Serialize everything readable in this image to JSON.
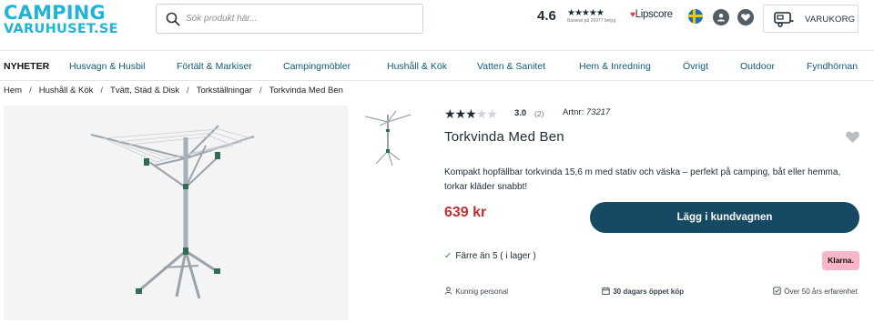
{
  "header": {
    "logo_line1": "CAMPING",
    "logo_line2": "VARUHUSET.SE",
    "search_placeholder": "Sök produkt här...",
    "store_rating": "4.6",
    "rating_stars": "★★★★★",
    "rating_subtext": "Baserat på 26977 betyg",
    "lipscore_label": "Lipscore",
    "cart_label": "VARUKORG",
    "icons": [
      "search-icon",
      "sweden-flag-icon",
      "user-icon",
      "heart-icon",
      "caravan-cart-icon"
    ]
  },
  "nav": {
    "items": [
      {
        "label": "NYHETER"
      },
      {
        "label": "Husvagn & Husbil"
      },
      {
        "label": "Förtält & Markiser"
      },
      {
        "label": "Campingmöbler"
      },
      {
        "label": "Hushåll & Kök"
      },
      {
        "label": "Vatten & Sanitet"
      },
      {
        "label": "Hem & Inredning"
      },
      {
        "label": "Övrigt"
      },
      {
        "label": "Outdoor"
      },
      {
        "label": "Fyndhörnan"
      }
    ]
  },
  "breadcrumb": [
    "Hem",
    "Hushåll & Kök",
    "Tvätt, Städ & Disk",
    "Torkställningar",
    "Torkvinda Med Ben"
  ],
  "product": {
    "rating": "3.0",
    "rating_fraction": 0.6,
    "review_count": "(2)",
    "article_label": "Artnr:",
    "article_number": "73217",
    "title": "Torkvinda Med Ben",
    "description": "Kompakt hopfällbar torkvinda 15,6 m med stativ och väska – perfekt på camping, båt eller hemma, torkar kläder snabbt!",
    "price": "639 kr",
    "buy_label": "Lägg i kundvagnen",
    "stock_text": "Färre än 5 ( i lager )",
    "klarna_label": "Klarna.",
    "usps": [
      {
        "text": "Kunnig personal",
        "icon": "person-icon"
      },
      {
        "text": "30 dagars öppet köp",
        "icon": "calendar-icon"
      },
      {
        "text": "Över 50 års erfarenhet",
        "icon": "checkbox-icon"
      }
    ]
  },
  "colors": {
    "brand": "#21b4d6",
    "primary_button": "#164a63",
    "price": "#c42f2f",
    "nav_link": "#0e5a78",
    "klarna": "#f8b7c8",
    "in_stock": "#2c9c3a"
  }
}
